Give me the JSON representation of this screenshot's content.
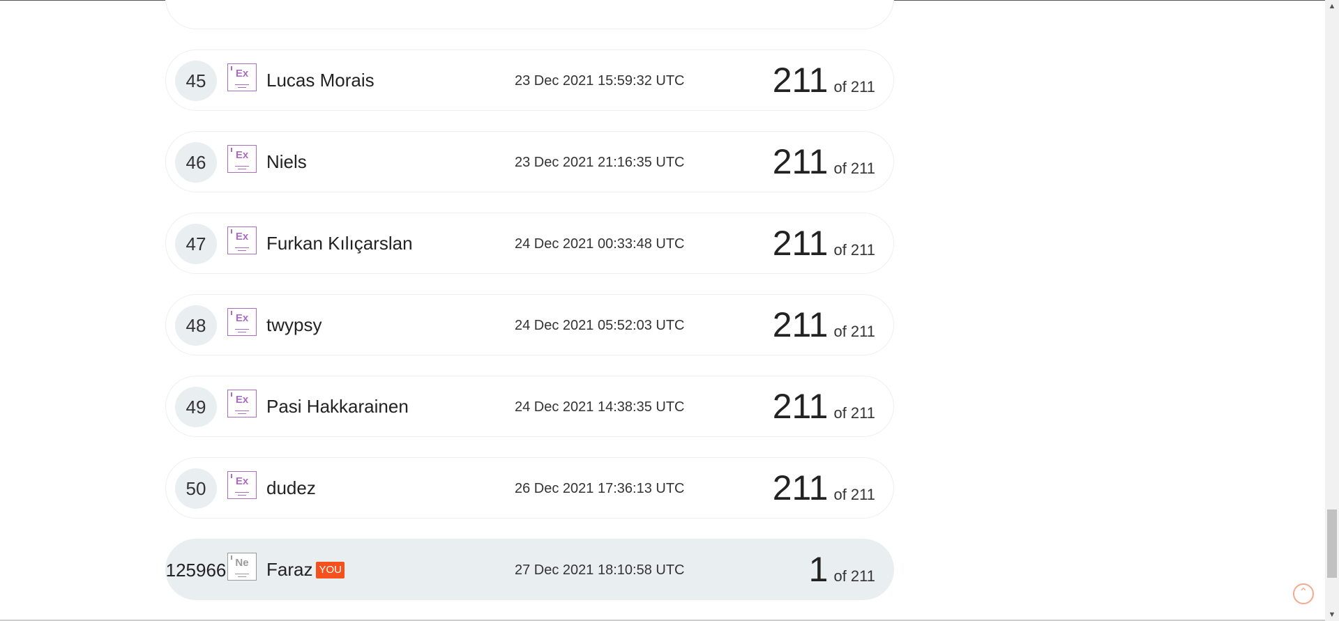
{
  "leaderboard": {
    "rows": [
      {
        "rank": "",
        "name": "",
        "date": "",
        "score": "",
        "of": ""
      },
      {
        "rank": "45",
        "badge": "Ex",
        "name": "Lucas Morais",
        "date": "23 Dec 2021 15:59:32 UTC",
        "score": "211",
        "of": "of 211"
      },
      {
        "rank": "46",
        "badge": "Ex",
        "name": "Niels",
        "date": "23 Dec 2021 21:16:35 UTC",
        "score": "211",
        "of": "of 211"
      },
      {
        "rank": "47",
        "badge": "Ex",
        "name": "Furkan Kılıçarslan",
        "date": "24 Dec 2021 00:33:48 UTC",
        "score": "211",
        "of": "of 211"
      },
      {
        "rank": "48",
        "badge": "Ex",
        "name": "twypsy",
        "date": "24 Dec 2021 05:52:03 UTC",
        "score": "211",
        "of": "of 211"
      },
      {
        "rank": "49",
        "badge": "Ex",
        "name": "Pasi Hakkarainen",
        "date": "24 Dec 2021 14:38:35 UTC",
        "score": "211",
        "of": "of 211"
      },
      {
        "rank": "50",
        "badge": "Ex",
        "name": "dudez",
        "date": "26 Dec 2021 17:36:13 UTC",
        "score": "211",
        "of": "of 211"
      }
    ],
    "current_user": {
      "rank": "125966",
      "badge": "Ne",
      "name": "Faraz",
      "you_label": "YOU",
      "date": "27 Dec 2021 18:10:58 UTC",
      "score": "1",
      "of": "of 211"
    }
  },
  "icons": {
    "back_to_top": "chevron-up-circle-icon",
    "scroll_up": "scroll-up-arrow-icon",
    "scroll_down": "scroll-down-arrow-icon"
  },
  "colors": {
    "expert_badge": "#a86cc1",
    "newbie_badge": "#9a9a9a",
    "you_tag": "#f4511e",
    "current_user_row": "#e9eef0"
  }
}
